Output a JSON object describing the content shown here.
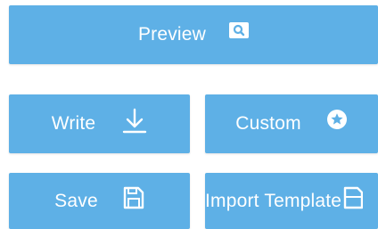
{
  "buttons": {
    "preview": {
      "label": "Preview",
      "icon": "search-icon"
    },
    "write": {
      "label": "Write",
      "icon": "download-arrow-icon"
    },
    "custom": {
      "label": "Custom",
      "icon": "star-circle-icon"
    },
    "save": {
      "label": "Save",
      "icon": "save-icon"
    },
    "import_template": {
      "label": "Import Template",
      "icon": "document-icon"
    }
  },
  "colors": {
    "button_background": "#5eb0e6",
    "button_text": "#ffffff"
  }
}
